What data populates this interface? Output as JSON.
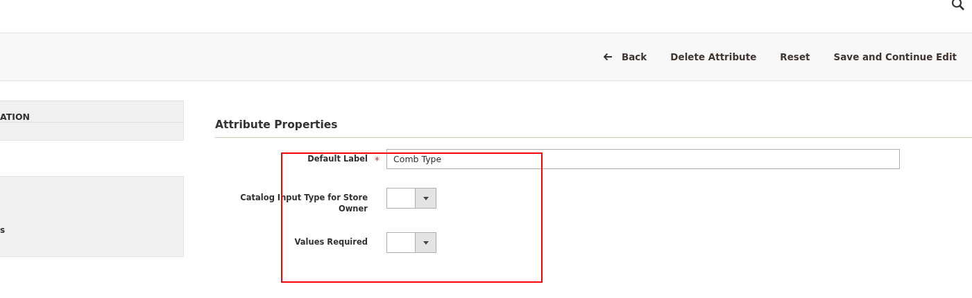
{
  "toolbar": {
    "buttons": [
      {
        "label": "Back",
        "kind": "back"
      },
      {
        "label": "Delete Attribute",
        "kind": "plain"
      },
      {
        "label": "Reset",
        "kind": "plain"
      },
      {
        "label": "Save and Continue Edit",
        "kind": "plain"
      }
    ]
  },
  "sidebar": {
    "tab": "ATION",
    "link": "s"
  },
  "section": {
    "title": "Attribute Properties"
  },
  "fields": [
    {
      "label": "Default Label",
      "required_mark": "*",
      "kind": "text",
      "value": "Comb Type"
    },
    {
      "label": "Catalog Input Type for Store Owner",
      "kind": "select"
    },
    {
      "label": "Values Required",
      "kind": "select"
    }
  ]
}
